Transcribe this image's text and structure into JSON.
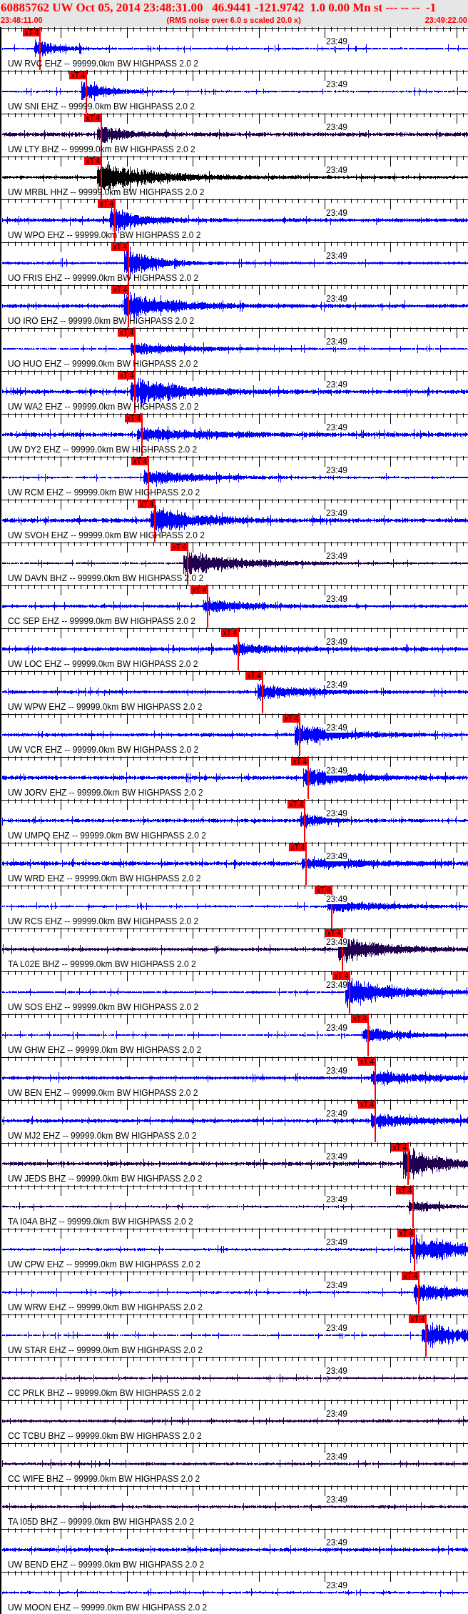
{
  "header": {
    "title": "60885762 UW Oct 05, 2014 23:48:31.00   46.9441 -121.9742  1.0 0.00 Mn st --- -- --  -1",
    "start_time": "23:48:11.00",
    "note": "(RMS noise over 6.0 s scaled 20.0 x)",
    "end_time": "23:49:22.00"
  },
  "traces": [
    {
      "label": "UW RVC EHZ -- 99999.0km BW HIGHPASS 2.0 2",
      "time_label": "23:49",
      "color": "#0000ff",
      "pick": {
        "label": "xT 4",
        "level": 0.084
      }
    },
    {
      "label": "UW SNI EHZ -- 99999.0km BW HIGHPASS 2.0 2",
      "time_label": "23:49",
      "color": "#0000ff",
      "pick": {
        "label": "xT 4",
        "level": 0.183
      }
    },
    {
      "label": "UW LTY BHZ -- 99999.0km BW HIGHPASS 2.0 2",
      "time_label": "23:49",
      "color": "#200050",
      "pick": {
        "label": "xT 4",
        "level": 0.216
      }
    },
    {
      "label": "UW MRBL HHZ -- 99999.0km BW HIGHPASS 2.0 2",
      "time_label": "23:49",
      "color": "#000000",
      "pick": {
        "label": "xT 4",
        "level": 0.216
      }
    },
    {
      "label": "UW WPO EHZ -- 99999.0km BW HIGHPASS 2.0 2",
      "time_label": "23:49",
      "color": "#0000ff",
      "pick": {
        "label": "xT 4",
        "level": 0.244
      }
    },
    {
      "label": "UO FRIS EHZ -- 99999.0km BW HIGHPASS 2.0 2",
      "time_label": "23:49",
      "color": "#0000ff",
      "pick": {
        "label": "xT 4",
        "level": 0.274
      }
    },
    {
      "label": "UO IRO EHZ -- 99999.0km BW HIGHPASS 2.0 2",
      "time_label": "23:49",
      "color": "#0000ff",
      "pick": {
        "label": "xT 4",
        "level": 0.274
      }
    },
    {
      "label": "UO HUO EHZ -- 99999.0km BW HIGHPASS 2.0 2",
      "time_label": "23:49",
      "color": "#0000ff",
      "pick": {
        "label": "xT 4",
        "level": 0.288
      }
    },
    {
      "label": "UW WA2 EHZ -- 99999.0km BW HIGHPASS 2.0 2",
      "time_label": "23:49",
      "color": "#0000ff",
      "pick": {
        "label": "xT 4",
        "level": 0.288
      }
    },
    {
      "label": "UW DY2 EHZ -- 99999.0km BW HIGHPASS 2.0 2",
      "time_label": "23:49",
      "color": "#0000ff",
      "pick": {
        "label": "xT 4",
        "level": 0.302
      }
    },
    {
      "label": "UW RCM EHZ -- 99999.0km BW HIGHPASS 2.0 2",
      "time_label": "23:49",
      "color": "#0000ff",
      "pick": {
        "label": "xT 4",
        "level": 0.316
      }
    },
    {
      "label": "UW SVOH EHZ -- 99999.0km BW HIGHPASS 2.0 2",
      "time_label": "23:49",
      "color": "#0000ff",
      "pick": {
        "label": "xT 4",
        "level": 0.331
      }
    },
    {
      "label": "UW DAVN BHZ -- 99999.0km BW HIGHPASS 2.0 2",
      "time_label": "23:49",
      "color": "#200050",
      "pick": {
        "label": "xT 4",
        "level": 0.401
      }
    },
    {
      "label": "CC SEP EHZ -- 99999.0km BW HIGHPASS 2.0 2",
      "time_label": "23:49",
      "color": "#0000ff",
      "pick": {
        "label": "xT 4",
        "level": 0.444
      }
    },
    {
      "label": "UW LOC EHZ -- 99999.0km BW HIGHPASS 2.0 2",
      "time_label": "23:49",
      "color": "#0000ff",
      "pick": {
        "label": "xT 4",
        "level": 0.509
      }
    },
    {
      "label": "UW WPW EHZ -- 99999.0km BW HIGHPASS 2.0 2",
      "time_label": "23:49",
      "color": "#0000ff",
      "pick": {
        "label": "xT 4",
        "level": 0.561
      }
    },
    {
      "label": "UW VCR EHZ -- 99999.0km BW HIGHPASS 2.0 2",
      "time_label": "23:49",
      "color": "#0000ff",
      "pick": {
        "label": "xT 4",
        "level": 0.64
      }
    },
    {
      "label": "UW JORV EHZ -- 99999.0km BW HIGHPASS 2.0 2",
      "time_label": "23:49",
      "color": "#0000ff",
      "pick": {
        "label": "xT 4",
        "level": 0.659
      }
    },
    {
      "label": "UW UMPQ EHZ -- 99999.0km BW HIGHPASS 2.0 2",
      "time_label": "23:49",
      "color": "#0000ff",
      "pick": {
        "label": "xT 4",
        "level": 0.652
      }
    },
    {
      "label": "UW WRD EHZ -- 99999.0km BW HIGHPASS 2.0 2",
      "time_label": "23:49",
      "color": "#0000ff",
      "pick": {
        "label": "xT 4",
        "level": 0.655
      }
    },
    {
      "label": "UW RCS EHZ -- 99999.0km BW HIGHPASS 2.0 2",
      "time_label": "23:49",
      "color": "#0000ff",
      "pick": {
        "label": "xT 4",
        "level": 0.71
      }
    },
    {
      "label": "TA L02E BHZ -- 99999.0km BW HIGHPASS 2.0 2",
      "time_label": "23:49",
      "color": "#200050",
      "pick": {
        "label": "xT 4",
        "level": 0.733
      }
    },
    {
      "label": "UW SOS EHZ -- 99999.0km BW HIGHPASS 2.0 2",
      "time_label": "23:49",
      "color": "#0000ff",
      "pick": {
        "label": "xT 4",
        "level": 0.748
      }
    },
    {
      "label": "UW GHW EHZ -- 99999.0km BW HIGHPASS 2.0 2",
      "time_label": "23:49",
      "color": "#0000ff",
      "pick": {
        "label": "xT 4",
        "level": 0.788
      }
    },
    {
      "label": "UW BEN EHZ -- 99999.0km BW HIGHPASS 2.0 2",
      "time_label": "23:49",
      "color": "#0000ff",
      "pick": {
        "label": "xT 4",
        "level": 0.803
      }
    },
    {
      "label": "UW MJ2 EHZ -- 99999.0km BW HIGHPASS 2.0 2",
      "time_label": "23:49",
      "color": "#0000ff",
      "pick": {
        "label": "xT 4",
        "level": 0.803
      }
    },
    {
      "label": "UW JEDS BHZ -- 99999.0km BW HIGHPASS 2.0 2",
      "time_label": "23:49",
      "color": "#200050",
      "pick": {
        "label": "xT 4",
        "level": 0.873
      }
    },
    {
      "label": "TA I04A BHZ -- 99999.0km BW HIGHPASS 2.0 2",
      "time_label": "23:49",
      "color": "#200050",
      "pick": {
        "label": "xT 4",
        "level": 0.884
      }
    },
    {
      "label": "UW CPW EHZ -- 99999.0km BW HIGHPASS 2.0 2",
      "time_label": "23:49",
      "color": "#0000ff",
      "pick": {
        "label": "xT 4",
        "level": 0.887
      }
    },
    {
      "label": "UW WRW EHZ -- 99999.0km BW HIGHPASS 2.0 2",
      "time_label": "23:49",
      "color": "#0000ff",
      "pick": {
        "label": "xT 4",
        "level": 0.896
      }
    },
    {
      "label": "UW STAR EHZ -- 99999.0km BW HIGHPASS 2.0 2",
      "time_label": "23:49",
      "color": "#0000ff",
      "pick": {
        "label": "xT 4",
        "level": 0.912
      }
    },
    {
      "label": "CC PRLK BHZ -- 99999.0km BW HIGHPASS 2.0 2",
      "time_label": "23:49",
      "color": "#200050"
    },
    {
      "label": "CC TCBU BHZ -- 99999.0km BW HIGHPASS 2.0 2",
      "time_label": "23:49",
      "color": "#200050"
    },
    {
      "label": "CC WIFE BHZ -- 99999.0km BW HIGHPASS 2.0 2",
      "time_label": "23:49",
      "color": "#200050"
    },
    {
      "label": "TA I05D BHZ -- 99999.0km BW HIGHPASS 2.0 2",
      "time_label": "23:49",
      "color": "#200050"
    },
    {
      "label": "UW BEND EHZ -- 99999.0km BW HIGHPASS 2.0 2",
      "time_label": "23:49",
      "color": "#0000ff"
    },
    {
      "label": "UW MOON EHZ -- 99999.0km BW HIGHPASS 2.0 2",
      "time_label": "23:49",
      "color": "#0000ff"
    }
  ]
}
